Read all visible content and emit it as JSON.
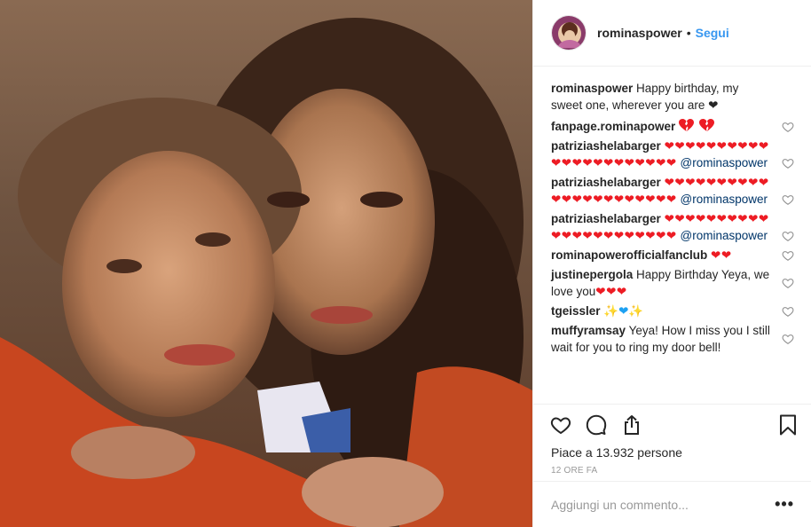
{
  "post": {
    "username": "rominaspower",
    "follow_label": "Segui",
    "separator": "•"
  },
  "caption": {
    "user": "rominaspower",
    "text": "Happy birthday, my sweet one, wherever you are",
    "emoji": "black-heart"
  },
  "comments": [
    {
      "user": "fanpage.rominapower",
      "text": "",
      "emoji": "broken-heart x2"
    },
    {
      "user": "patriziashelabarger",
      "text": "",
      "emoji": "red-heart x22",
      "mention": "@rominaspower"
    },
    {
      "user": "patriziashelabarger",
      "text": "",
      "emoji": "red-heart x22",
      "mention": "@rominaspower"
    },
    {
      "user": "patriziashelabarger",
      "text": "",
      "emoji": "red-heart x22",
      "mention": "@rominaspower"
    },
    {
      "user": "rominapowerofficialfanclub",
      "text": "",
      "emoji": "red-heart x2"
    },
    {
      "user": "justinepergola",
      "text": "Happy Birthday Yeya, we love you",
      "emoji": "red-heart x3"
    },
    {
      "user": "tgeissler",
      "text": "",
      "emoji": "sparkles, blue-heart, sparkles"
    },
    {
      "user": "muffyramsay",
      "text": "Yeya! How I miss you I still wait for you to ring my door bell!",
      "emoji": ""
    }
  ],
  "likes_text": "Piace a 13.932 persone",
  "timestamp": "12 ORE FA",
  "comment_input": {
    "placeholder": "Aggiungi un commento..."
  },
  "more_label": "•••",
  "icons": [
    "heart-outline-icon",
    "comment-icon",
    "share-icon",
    "bookmark-icon"
  ],
  "colors": {
    "follow": "#3897f0",
    "heart": "#ed1c24",
    "mention": "#003569",
    "muted": "#999999"
  }
}
